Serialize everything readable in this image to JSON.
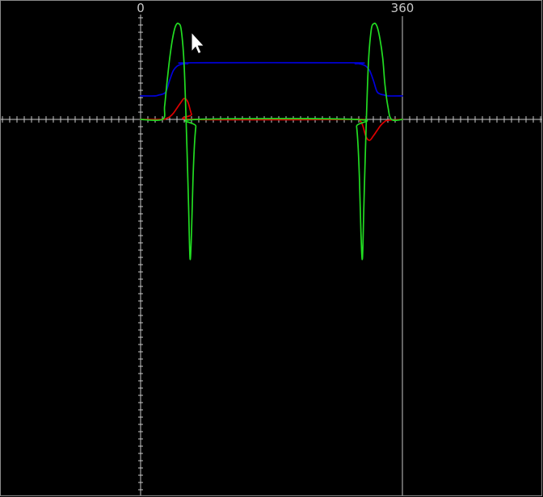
{
  "chart_data": {
    "type": "line",
    "title": "",
    "xlabel": "",
    "ylabel": "",
    "grid": false,
    "x_tick_labels": [
      {
        "value": 0,
        "text": "0"
      },
      {
        "value": 360,
        "text": "360"
      }
    ],
    "xlim": [
      0,
      360
    ],
    "ylim": [
      -1.7,
      1.4
    ],
    "series": [
      {
        "color": "#0000dd",
        "x": [
          0,
          20,
          25,
          30,
          35,
          40,
          45,
          50,
          55,
          60,
          65,
          70,
          290,
          295,
          300,
          305,
          310,
          315,
          320,
          325,
          330,
          335,
          340,
          360
        ],
        "y": [
          0.27,
          0.27,
          0.28,
          0.29,
          0.32,
          0.45,
          0.56,
          0.61,
          0.63,
          0.64,
          0.64,
          0.65,
          0.65,
          0.64,
          0.64,
          0.63,
          0.61,
          0.56,
          0.45,
          0.32,
          0.29,
          0.28,
          0.27,
          0.27
        ]
      },
      {
        "color": "#dd0000",
        "x": [
          0,
          30,
          35,
          40,
          45,
          50,
          55,
          60,
          65,
          70,
          75,
          290,
          295,
          300,
          305,
          310,
          315,
          320,
          325,
          330,
          335,
          340,
          360
        ],
        "y": [
          0,
          0,
          0.01,
          0.03,
          0.07,
          0.13,
          0.19,
          0.24,
          0.2,
          0.06,
          0,
          0,
          0,
          0,
          -0.06,
          -0.2,
          -0.24,
          -0.19,
          -0.13,
          -0.07,
          -0.03,
          -0.01,
          0
        ]
      },
      {
        "color": "#22dd22",
        "x": [
          0,
          30,
          33,
          36,
          40,
          44,
          48,
          52,
          56,
          60,
          64,
          66,
          68,
          70,
          72,
          74,
          76,
          78,
          295,
          297,
          299,
          301,
          303,
          305,
          307,
          309,
          313,
          317,
          321,
          325,
          329,
          333,
          336,
          340,
          345,
          360
        ],
        "y": [
          0,
          0,
          0.15,
          0.4,
          0.7,
          0.93,
          1.07,
          1.1,
          1.02,
          0.6,
          -0.4,
          -1.0,
          -1.6,
          -1.3,
          -0.7,
          -0.3,
          -0.08,
          0,
          0,
          -0.08,
          -0.3,
          -0.7,
          -1.3,
          -1.6,
          -1.0,
          -0.4,
          0.6,
          1.02,
          1.1,
          1.07,
          0.93,
          0.7,
          0.4,
          0.15,
          0,
          0
        ]
      }
    ]
  }
}
